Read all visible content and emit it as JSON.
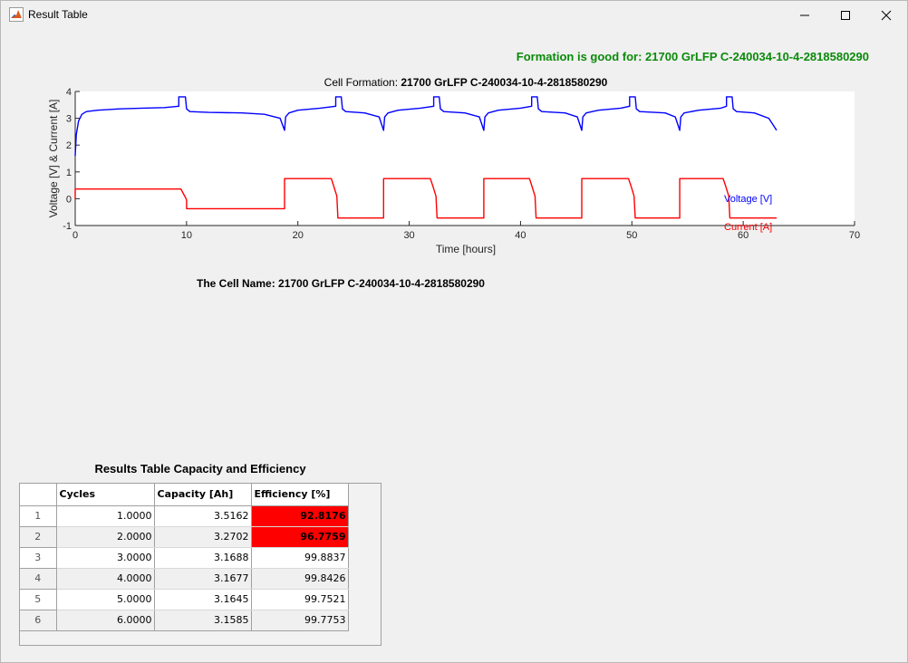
{
  "window": {
    "title": "Result Table"
  },
  "status_message": "Formation is good for: 21700 GrLFP C-240034-10-4-2818580290",
  "chart_data": {
    "type": "line",
    "title_prefix": "Cell Formation: ",
    "title_cell": "21700 GrLFP C-240034-10-4-2818580290",
    "xlabel": "Time [hours]",
    "ylabel": "Voltage [V] & Current [A]",
    "xlim": [
      0,
      70
    ],
    "ylim": [
      -1,
      4
    ],
    "xticks": [
      0,
      10,
      20,
      30,
      40,
      50,
      60,
      70
    ],
    "yticks": [
      -1,
      0,
      1,
      2,
      3,
      4
    ],
    "grid": false,
    "legend_placement": "inline-right",
    "series": [
      {
        "name": "Voltage [V]",
        "color": "#0000ff",
        "x": [
          0,
          0.1,
          0.3,
          0.6,
          1.0,
          2,
          4,
          6,
          8,
          9.3,
          9.3,
          9.9,
          10.0,
          10.3,
          12,
          15,
          17,
          18.4,
          18.8,
          18.9,
          19.2,
          20,
          22,
          23.4,
          23.4,
          23.9,
          24.0,
          24.3,
          26,
          27.3,
          27.7,
          27.8,
          28.1,
          29,
          31,
          32.2,
          32.2,
          32.7,
          32.8,
          33.1,
          35,
          36.3,
          36.7,
          36.8,
          37.1,
          38,
          40,
          41.0,
          41.0,
          41.5,
          41.6,
          41.9,
          44,
          45.1,
          45.5,
          45.6,
          45.9,
          47,
          49,
          49.8,
          49.8,
          50.3,
          50.4,
          50.7,
          53,
          53.9,
          54.3,
          54.4,
          54.7,
          56,
          58,
          58.5,
          58.5,
          59.0,
          59.1,
          59.4,
          61,
          62.3,
          63.0
        ],
        "y": [
          1.6,
          2.4,
          2.9,
          3.15,
          3.25,
          3.3,
          3.35,
          3.38,
          3.4,
          3.45,
          3.8,
          3.8,
          3.35,
          3.25,
          3.22,
          3.2,
          3.15,
          3.0,
          2.55,
          3.05,
          3.2,
          3.3,
          3.38,
          3.45,
          3.8,
          3.8,
          3.35,
          3.25,
          3.2,
          3.05,
          2.55,
          3.05,
          3.2,
          3.3,
          3.38,
          3.45,
          3.8,
          3.8,
          3.35,
          3.25,
          3.2,
          3.05,
          2.55,
          3.05,
          3.2,
          3.3,
          3.38,
          3.45,
          3.8,
          3.8,
          3.35,
          3.25,
          3.2,
          3.05,
          2.55,
          3.05,
          3.2,
          3.3,
          3.38,
          3.45,
          3.8,
          3.8,
          3.35,
          3.25,
          3.2,
          3.05,
          2.55,
          3.05,
          3.2,
          3.3,
          3.38,
          3.45,
          3.8,
          3.8,
          3.35,
          3.25,
          3.2,
          3.0,
          2.55
        ]
      },
      {
        "name": "Current [A]",
        "color": "#ff0000",
        "x": [
          0,
          0,
          9.5,
          9.7,
          9.9,
          10.0,
          10.0,
          18.8,
          18.8,
          23.0,
          23.2,
          23.5,
          23.6,
          27.7,
          27.7,
          31.9,
          32.1,
          32.4,
          32.5,
          36.7,
          36.7,
          40.8,
          41.0,
          41.3,
          41.4,
          45.5,
          45.5,
          49.7,
          49.9,
          50.2,
          50.3,
          54.3,
          54.3,
          58.2,
          58.4,
          58.7,
          58.8,
          63.0
        ],
        "y": [
          0,
          0.36,
          0.36,
          0.2,
          0.05,
          -0.05,
          -0.37,
          -0.37,
          0.75,
          0.75,
          0.5,
          0.1,
          -0.72,
          -0.72,
          0.75,
          0.75,
          0.5,
          0.1,
          -0.72,
          -0.72,
          0.75,
          0.75,
          0.5,
          0.1,
          -0.72,
          -0.72,
          0.75,
          0.75,
          0.5,
          0.1,
          -0.72,
          -0.72,
          0.75,
          0.75,
          0.5,
          0.1,
          -0.72,
          -0.72
        ]
      }
    ]
  },
  "cell_name_label": "The Cell Name: 21700 GrLFP C-240034-10-4-2818580290",
  "results_table": {
    "title": "Results Table Capacity and Efficiency",
    "columns": [
      "",
      "Cycles",
      "Capacity [Ah]",
      "Efficiency [%]"
    ],
    "rows": [
      {
        "index": "1",
        "cycles": "1.0000",
        "capacity": "3.5162",
        "efficiency": "92.8176",
        "flagged": true
      },
      {
        "index": "2",
        "cycles": "2.0000",
        "capacity": "3.2702",
        "efficiency": "96.7759",
        "flagged": true
      },
      {
        "index": "3",
        "cycles": "3.0000",
        "capacity": "3.1688",
        "efficiency": "99.8837",
        "flagged": false
      },
      {
        "index": "4",
        "cycles": "4.0000",
        "capacity": "3.1677",
        "efficiency": "99.8426",
        "flagged": false
      },
      {
        "index": "5",
        "cycles": "5.0000",
        "capacity": "3.1645",
        "efficiency": "99.7521",
        "flagged": false
      },
      {
        "index": "6",
        "cycles": "6.0000",
        "capacity": "3.1585",
        "efficiency": "99.7753",
        "flagged": false
      }
    ],
    "flag_color": "#ff0000"
  },
  "colors": {
    "status_ok": "#0a8a0a"
  },
  "icons": {
    "app": "matlab-icon",
    "minimize": "minimize-icon",
    "maximize": "maximize-icon",
    "close": "close-icon"
  }
}
